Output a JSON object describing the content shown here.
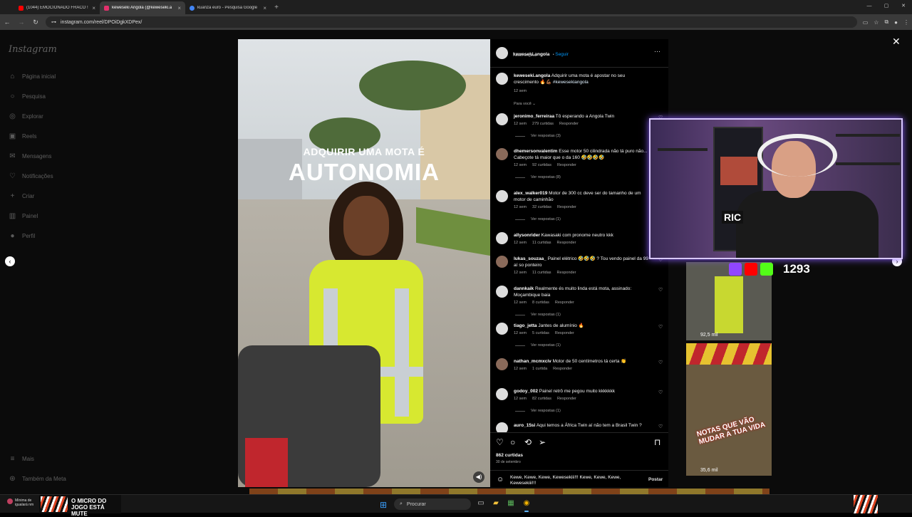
{
  "browser": {
    "tabs": [
      {
        "title": "(1044) EMOCIONADO FRACO !",
        "color": "#ff0000",
        "active": false
      },
      {
        "title": "keweseki Angola (@keweseki.a",
        "color": "#e1306c",
        "active": true
      },
      {
        "title": "kuanza euro - Pesquisa Google",
        "color": "#4285f4",
        "active": false
      }
    ],
    "url": "instagram.com/reel/DPOiDgkXDPex/"
  },
  "sidebar": {
    "logo": "Instagram",
    "items": [
      {
        "label": "Página inicial",
        "icon": "home-icon",
        "glyph": "⌂"
      },
      {
        "label": "Pesquisa",
        "icon": "search-icon",
        "glyph": "○"
      },
      {
        "label": "Explorar",
        "icon": "compass-icon",
        "glyph": "◎"
      },
      {
        "label": "Reels",
        "icon": "reels-icon",
        "glyph": "▣"
      },
      {
        "label": "Mensagens",
        "icon": "messenger-icon",
        "glyph": "✉"
      },
      {
        "label": "Notificações",
        "icon": "heart-icon",
        "glyph": "♡"
      },
      {
        "label": "Criar",
        "icon": "plus-icon",
        "glyph": "+"
      },
      {
        "label": "Painel",
        "icon": "dashboard-icon",
        "glyph": "▥"
      },
      {
        "label": "Perfil",
        "icon": "avatar-icon",
        "glyph": "●"
      }
    ],
    "bottom": [
      {
        "label": "Mais",
        "icon": "menu-icon",
        "glyph": "≡"
      },
      {
        "label": "Também da Meta",
        "icon": "meta-icon",
        "glyph": "⊛"
      }
    ]
  },
  "video": {
    "line1": "ADQUIRIR UMA MOTA É",
    "line2": "AUTONOMIA"
  },
  "post": {
    "username": "keweseki.angola",
    "follow": "Seguir",
    "audio": "Áudio original",
    "caption_user": "keweseki.angola",
    "caption": "Adquirir uma mota é apostar no seu crescimento 🔥💪🏾",
    "hashtag": "#kewesekiangola",
    "caption_time": "12 sem",
    "sort": "Para você ⌄",
    "likes": "862 curtidas",
    "date": "30 de setembro",
    "comment_input": "Kewe, Kewe, Kewe, Kewesekiii!!! Kewe, Kewe, Kewe, Kewesekiii!!!",
    "post_button": "Postar"
  },
  "comments": [
    {
      "user": "jeronimo_ferreiraa",
      "text": "Tô esperando a Angola Twin",
      "time": "12 sem",
      "likes": "279 curtidas",
      "reply": "Responder",
      "replies": "Ver respostas (3)"
    },
    {
      "user": "dhemersonvalentim",
      "text": "Esse motor 50 cilindrada não tá puro não... Cabeçote tá maior que o da 160 🤣🤣🤣🤣",
      "time": "12 sem",
      "likes": "92 curtidas",
      "reply": "Responder",
      "replies": "Ver respostas (8)"
    },
    {
      "user": "alex_walker019",
      "text": "Motor de 300 cc deve ser do tamanho de um motor de caminhão",
      "time": "12 sem",
      "likes": "32 curtidas",
      "reply": "Responder",
      "replies": "Ver respostas (1)"
    },
    {
      "user": "allysonrider",
      "text": "Kawasaki com pronome neutro kkk",
      "time": "12 sem",
      "likes": "11 curtidas",
      "reply": "Responder",
      "replies": ""
    },
    {
      "user": "lukas_souzaa_",
      "text": "Painel elétrico 🤣🤣🤣 ? Tou vendo painel da 99 aí so ponteiro",
      "time": "12 sem",
      "likes": "11 curtidas",
      "reply": "Responder",
      "replies": ""
    },
    {
      "user": "dannkaik",
      "text": "Realmente és muito linda está mota, assinado: Moçambique baia",
      "time": "12 sem",
      "likes": "8 curtidas",
      "reply": "Responder",
      "replies": "Ver respostas (1)"
    },
    {
      "user": "tiago_jetta",
      "text": "Jantes de alumínio 🔥",
      "time": "12 sem",
      "likes": "5 curtidas",
      "reply": "Responder",
      "replies": "Ver respostas (1)"
    },
    {
      "user": "nathan_mcmxciv",
      "text": "Motor de 50 centímetros tá certa 👏",
      "time": "12 sem",
      "likes": "1 curtida",
      "reply": "Responder",
      "replies": ""
    },
    {
      "user": "godoy_002",
      "text": "Painel retrô me pegou muito kkkkkkk",
      "time": "12 sem",
      "likes": "82 curtidas",
      "reply": "Responder",
      "replies": "Ver respostas (1)"
    },
    {
      "user": "auro_15si",
      "text": "Aqui temos a África Twin aí não tem a Brasil Twin ?",
      "time": "",
      "likes": "",
      "reply": "",
      "replies": ""
    }
  ],
  "thumbs": [
    {
      "views": "92,5 mil"
    },
    {
      "views": "35,6 mil",
      "overlay": "NOTAS QUE VÃO MUDAR A TUA VIDA"
    }
  ],
  "stream": {
    "count": "1293",
    "cam_sign": "RIC"
  },
  "taskbar": {
    "notification": "Mínima de igualará nm",
    "brand": "O MICRO DO JOGO ESTÁ MUTE",
    "search": "Procurar"
  }
}
